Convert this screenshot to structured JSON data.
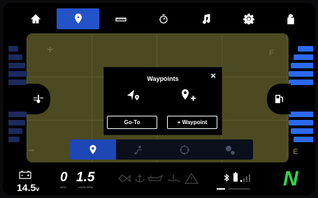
{
  "top_tabs": [
    {
      "icon": "home-icon",
      "active": false
    },
    {
      "icon": "map-pin-icon",
      "active": true
    },
    {
      "icon": "ruler-icon",
      "active": false
    },
    {
      "icon": "timer-icon",
      "active": false
    },
    {
      "icon": "music-note-icon",
      "active": false
    },
    {
      "icon": "gear-icon",
      "active": false
    },
    {
      "icon": "unlock-icon",
      "active": false
    }
  ],
  "map": {
    "zoom_in": "+",
    "zoom_out": "−",
    "edge_top": "F",
    "edge_bottom": "E"
  },
  "dialog": {
    "title": "Waypoints",
    "close": "×",
    "goto_label": "Go-To",
    "add_label": "+ Waypoint"
  },
  "mode_bar": [
    {
      "icon": "map-pin-icon",
      "active": true
    },
    {
      "icon": "route-icon",
      "active": false
    },
    {
      "icon": "target-icon",
      "active": false
    },
    {
      "icon": "settings-icon",
      "active": false
    }
  ],
  "status": {
    "voltage": "14.5",
    "voltage_unit": "v",
    "speed": "0",
    "speed_unit": "MPH",
    "rpm": "1.5",
    "rpm_unit": "x1000 RPM",
    "gear": "N"
  },
  "colors": {
    "accent": "#2352c9",
    "gear_indicator": "#2ed84a",
    "map": "#4b4a21"
  }
}
